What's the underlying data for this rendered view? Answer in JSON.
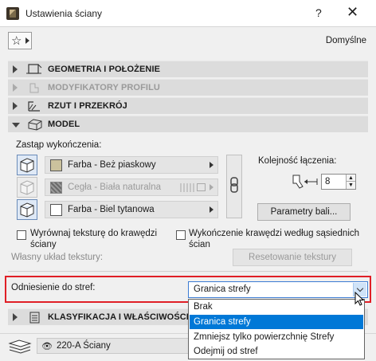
{
  "window": {
    "title": "Ustawienia ściany",
    "help": "?",
    "close": "✕"
  },
  "favorites": {
    "star": "☆",
    "default_label": "Domyślne"
  },
  "sections": [
    {
      "label": "GEOMETRIA I POŁOŻENIE",
      "icon": "geometry-icon",
      "state": "collapsed"
    },
    {
      "label": "MODYFIKATORY PROFILU",
      "icon": "profile-icon",
      "state": "disabled"
    },
    {
      "label": "RZUT I PRZEKRÓJ",
      "icon": "floor-plan-icon",
      "state": "collapsed"
    },
    {
      "label": "MODEL",
      "icon": "model-icon",
      "state": "expanded"
    }
  ],
  "model": {
    "override_label": "Zastąp wykończenia:",
    "materials": [
      {
        "name": "Farba - Beż piaskowy",
        "swatch": "#cbc29d",
        "enabled": true
      },
      {
        "name": "Cegła - Biała naturalna",
        "swatch": "#8a8a8a",
        "enabled": false
      },
      {
        "name": "Farba - Biel tytanowa",
        "swatch": "#ffffff",
        "enabled": true
      }
    ],
    "join_order_label": "Kolejność łączenia:",
    "join_order_value": "8",
    "params_button": "Parametry bali...",
    "align_texture_label": "Wyrównaj teksturę do krawędzi ściany",
    "align_texture_label_lines": [
      "Wyrównaj teksturę do krawędzi",
      "ściany"
    ],
    "edge_finish_label_lines": [
      "Wykończenie krawędzi według sąsiednich",
      "ścian"
    ],
    "custom_texture_label": "Własny układ tekstury:",
    "reset_texture_button": "Resetowanie tekstury"
  },
  "zone": {
    "label": "Odniesienie do stref:",
    "selected": "Granica strefy",
    "options": [
      "Brak",
      "Granica strefy",
      "Zmniejsz tylko powierzchnię Strefy",
      "Odejmij od stref"
    ],
    "selected_index": 1
  },
  "classification": {
    "label": "KLASYFIKACJA I WŁAŚCIWOŚCI"
  },
  "layer": {
    "value": "220-A Ściany",
    "icon": "eye-icon"
  },
  "colors": {
    "accent": "#0078d7",
    "highlight": "#e01f26",
    "section_bg": "#dcdcdc"
  }
}
